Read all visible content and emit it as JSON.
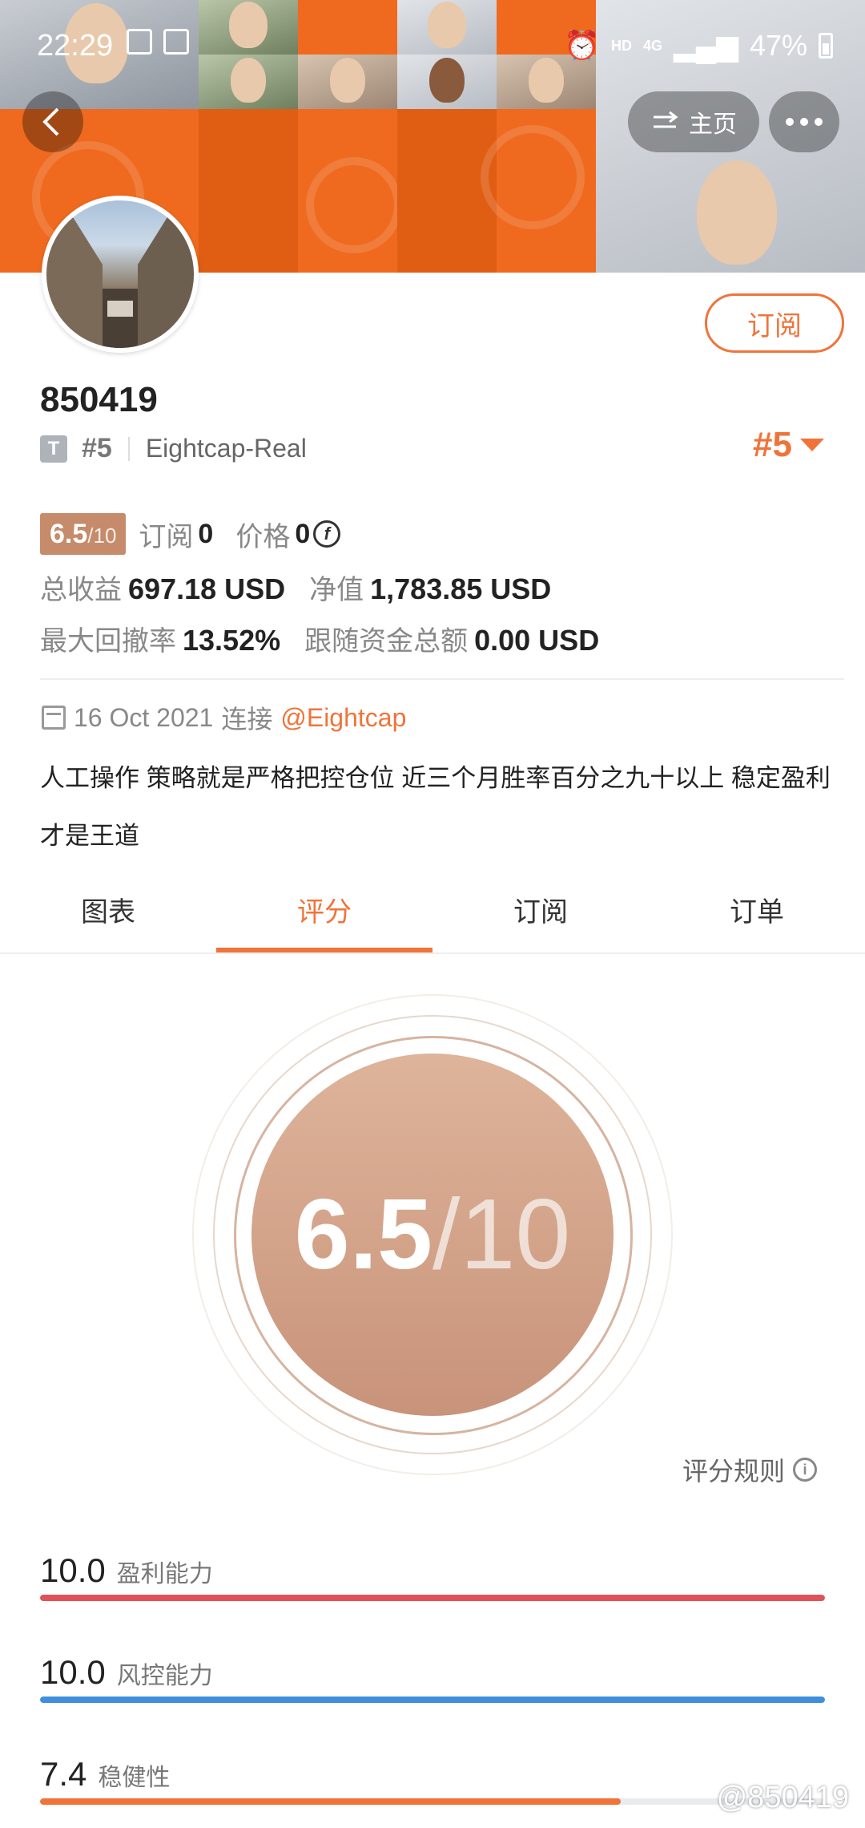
{
  "status_bar": {
    "time": "22:29",
    "network": "HD",
    "signal": "4G",
    "battery": "47%"
  },
  "nav": {
    "home_label": "主页"
  },
  "profile": {
    "name": "850419",
    "badge": "T",
    "rank_small": "#5",
    "broker": "Eightcap-Real",
    "rank_big": "#5",
    "subscribe_label": "订阅"
  },
  "stats": {
    "score_main": "6.5",
    "score_den": "/10",
    "subscribe_label": "订阅",
    "subscribe_count": "0",
    "price_label": "价格",
    "price_value": "0",
    "currency_symbol": "f",
    "total_profit_label": "总收益",
    "total_profit_value": "697.18 USD",
    "equity_label": "净值",
    "equity_value": "1,783.85 USD",
    "max_dd_label": "最大回撤率",
    "max_dd_value": "13.52%",
    "follow_funds_label": "跟随资金总额",
    "follow_funds_value": "0.00 USD"
  },
  "since": {
    "date": "16 Oct 2021",
    "connect_label": "连接",
    "link": "@Eightcap"
  },
  "description": "人工操作 策略就是严格把控仓位 近三个月胜率百分之九十以上 稳定盈利才是王道",
  "tabs": [
    {
      "label": "图表",
      "active": false
    },
    {
      "label": "评分",
      "active": true
    },
    {
      "label": "订阅",
      "active": false
    },
    {
      "label": "订单",
      "active": false
    }
  ],
  "score": {
    "main": "6.5",
    "den": "/10",
    "rules_label": "评分规则",
    "info_icon": "i"
  },
  "metrics": [
    {
      "value": "10.0",
      "label": "盈利能力",
      "ratio": 1.0,
      "color": "#e0525a"
    },
    {
      "value": "10.0",
      "label": "风控能力",
      "ratio": 1.0,
      "color": "#3f8fdc"
    },
    {
      "value": "7.4",
      "label": "稳健性",
      "ratio": 0.74,
      "color": "#f0743a"
    }
  ],
  "watermark": "@850419",
  "colors": {
    "accent": "#f0743a",
    "score_chip": "#c58b6b"
  }
}
